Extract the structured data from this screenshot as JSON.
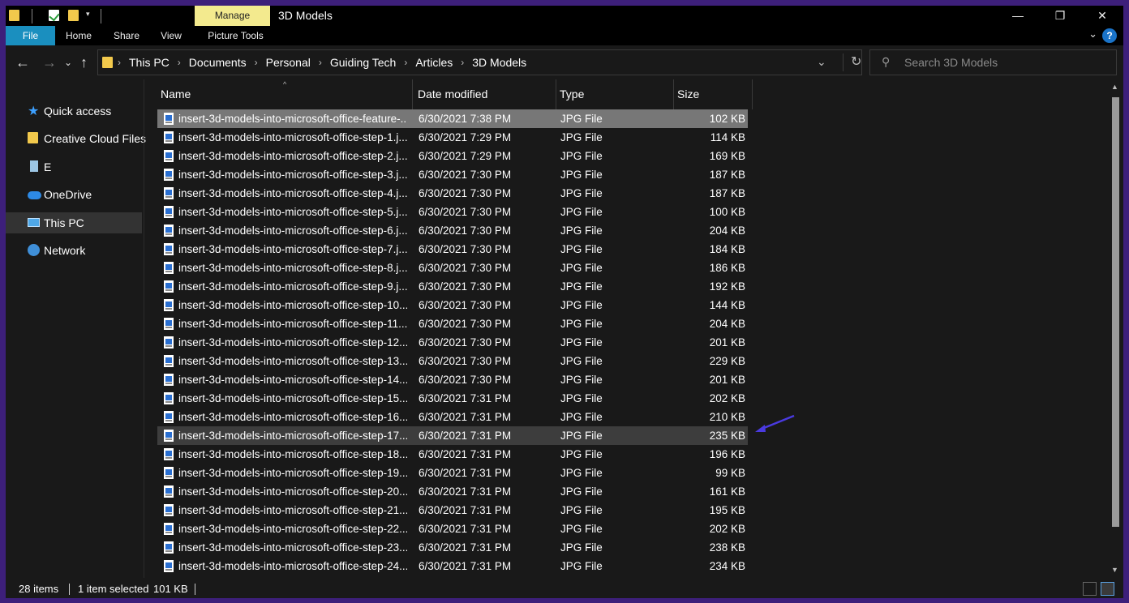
{
  "window": {
    "title": "3D Models",
    "manage_tab": "Manage",
    "controls": [
      "—",
      "❐",
      "✕"
    ]
  },
  "ribbon": {
    "tabs": [
      "File",
      "Home",
      "Share",
      "View",
      "Picture Tools"
    ],
    "help": "?"
  },
  "address": {
    "crumbs": [
      "This PC",
      "Documents",
      "Personal",
      "Guiding Tech",
      "Articles",
      "3D Models"
    ]
  },
  "search": {
    "placeholder": "Search 3D Models"
  },
  "nav": {
    "items": [
      {
        "label": "Quick access",
        "icon": "star-icon"
      },
      {
        "label": "Creative Cloud Files",
        "icon": "folder-icon"
      },
      {
        "label": "E",
        "icon": "drive-icon"
      },
      {
        "label": "OneDrive",
        "icon": "cloud-icon"
      },
      {
        "label": "This PC",
        "icon": "computer-icon"
      },
      {
        "label": "Network",
        "icon": "network-icon"
      }
    ]
  },
  "columns": {
    "name": "Name",
    "date": "Date modified",
    "type": "Type",
    "size": "Size"
  },
  "files": [
    {
      "name": "insert-3d-models-into-microsoft-office-feature-...",
      "date": "6/30/2021 7:38 PM",
      "type": "JPG File",
      "size": "102 KB"
    },
    {
      "name": "insert-3d-models-into-microsoft-office-step-1.j...",
      "date": "6/30/2021 7:29 PM",
      "type": "JPG File",
      "size": "114 KB"
    },
    {
      "name": "insert-3d-models-into-microsoft-office-step-2.j...",
      "date": "6/30/2021 7:29 PM",
      "type": "JPG File",
      "size": "169 KB"
    },
    {
      "name": "insert-3d-models-into-microsoft-office-step-3.j...",
      "date": "6/30/2021 7:30 PM",
      "type": "JPG File",
      "size": "187 KB"
    },
    {
      "name": "insert-3d-models-into-microsoft-office-step-4.j...",
      "date": "6/30/2021 7:30 PM",
      "type": "JPG File",
      "size": "187 KB"
    },
    {
      "name": "insert-3d-models-into-microsoft-office-step-5.j...",
      "date": "6/30/2021 7:30 PM",
      "type": "JPG File",
      "size": "100 KB"
    },
    {
      "name": "insert-3d-models-into-microsoft-office-step-6.j...",
      "date": "6/30/2021 7:30 PM",
      "type": "JPG File",
      "size": "204 KB"
    },
    {
      "name": "insert-3d-models-into-microsoft-office-step-7.j...",
      "date": "6/30/2021 7:30 PM",
      "type": "JPG File",
      "size": "184 KB"
    },
    {
      "name": "insert-3d-models-into-microsoft-office-step-8.j...",
      "date": "6/30/2021 7:30 PM",
      "type": "JPG File",
      "size": "186 KB"
    },
    {
      "name": "insert-3d-models-into-microsoft-office-step-9.j...",
      "date": "6/30/2021 7:30 PM",
      "type": "JPG File",
      "size": "192 KB"
    },
    {
      "name": "insert-3d-models-into-microsoft-office-step-10...",
      "date": "6/30/2021 7:30 PM",
      "type": "JPG File",
      "size": "144 KB"
    },
    {
      "name": "insert-3d-models-into-microsoft-office-step-11...",
      "date": "6/30/2021 7:30 PM",
      "type": "JPG File",
      "size": "204 KB"
    },
    {
      "name": "insert-3d-models-into-microsoft-office-step-12...",
      "date": "6/30/2021 7:30 PM",
      "type": "JPG File",
      "size": "201 KB"
    },
    {
      "name": "insert-3d-models-into-microsoft-office-step-13...",
      "date": "6/30/2021 7:30 PM",
      "type": "JPG File",
      "size": "229 KB"
    },
    {
      "name": "insert-3d-models-into-microsoft-office-step-14...",
      "date": "6/30/2021 7:30 PM",
      "type": "JPG File",
      "size": "201 KB"
    },
    {
      "name": "insert-3d-models-into-microsoft-office-step-15...",
      "date": "6/30/2021 7:31 PM",
      "type": "JPG File",
      "size": "202 KB"
    },
    {
      "name": "insert-3d-models-into-microsoft-office-step-16...",
      "date": "6/30/2021 7:31 PM",
      "type": "JPG File",
      "size": "210 KB"
    },
    {
      "name": "insert-3d-models-into-microsoft-office-step-17...",
      "date": "6/30/2021 7:31 PM",
      "type": "JPG File",
      "size": "235 KB"
    },
    {
      "name": "insert-3d-models-into-microsoft-office-step-18...",
      "date": "6/30/2021 7:31 PM",
      "type": "JPG File",
      "size": "196 KB"
    },
    {
      "name": "insert-3d-models-into-microsoft-office-step-19...",
      "date": "6/30/2021 7:31 PM",
      "type": "JPG File",
      "size": "99 KB"
    },
    {
      "name": "insert-3d-models-into-microsoft-office-step-20...",
      "date": "6/30/2021 7:31 PM",
      "type": "JPG File",
      "size": "161 KB"
    },
    {
      "name": "insert-3d-models-into-microsoft-office-step-21...",
      "date": "6/30/2021 7:31 PM",
      "type": "JPG File",
      "size": "195 KB"
    },
    {
      "name": "insert-3d-models-into-microsoft-office-step-22...",
      "date": "6/30/2021 7:31 PM",
      "type": "JPG File",
      "size": "202 KB"
    },
    {
      "name": "insert-3d-models-into-microsoft-office-step-23...",
      "date": "6/30/2021 7:31 PM",
      "type": "JPG File",
      "size": "238 KB"
    },
    {
      "name": "insert-3d-models-into-microsoft-office-step-24...",
      "date": "6/30/2021 7:31 PM",
      "type": "JPG File",
      "size": "234 KB"
    }
  ],
  "status": {
    "items": "28 items",
    "selected": "1 item selected",
    "selected_size": "101 KB"
  },
  "colors": {
    "background": "#191919",
    "accent": "#1a8fbf",
    "manage_tab": "#f3ea8e",
    "frame": "#3d1f7a",
    "annotation_arrow": "#4a3ae0"
  }
}
